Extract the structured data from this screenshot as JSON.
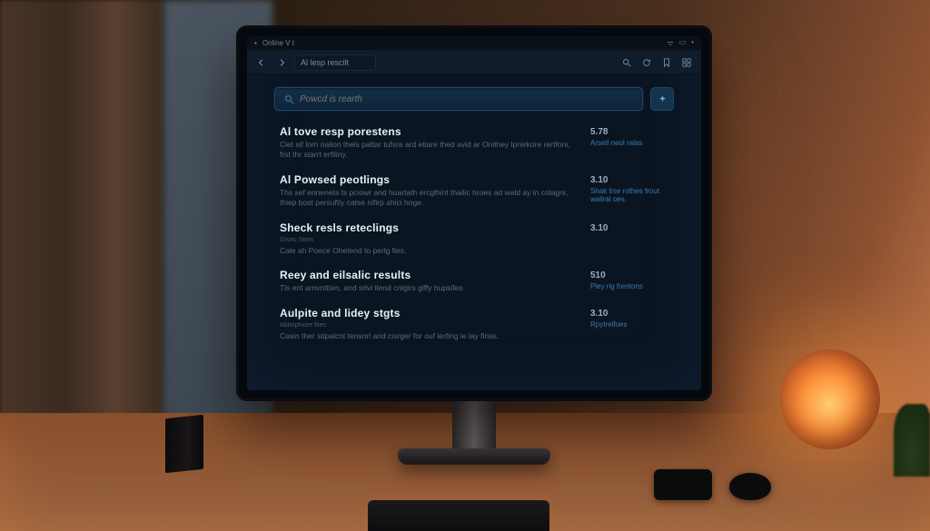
{
  "menubar": {
    "left_label": "Online  V  t"
  },
  "toolbar": {
    "address": "Al lesp rescilt"
  },
  "search": {
    "placeholder": "Powcd is rearth"
  },
  "results": [
    {
      "title": "Al tove resp porestens",
      "subtitle": "",
      "desc": "Ciet sif lorn nalion thels pattar tufsra ard etiare thed avid ar Onithey lprerkore rertfors, frst thr starrt erfiliny.",
      "value": "5.78",
      "action": "Arsetl neol ralas"
    },
    {
      "title": "Al Powsed peotlings",
      "subtitle": "",
      "desc": "Ths sef ennenets ts pciowr and huartath ercglhint thailic hroes ad wald ay in colagnr, thiep bost persuftiy catse nifirp ahici hoge.",
      "value": "3.10",
      "action": "Shak lrse rothes frout waliral oes."
    },
    {
      "title": "Sheck resls reteclings",
      "subtitle": "Grsec Stem",
      "desc": "Cale ah Poece Ohetend to perlg fies.",
      "value": "3.10",
      "action": ""
    },
    {
      "title": "Reey and eilsalic results",
      "subtitle": "",
      "desc": "Tls ent arnvnttten, and srlvi tlend cnlgirs glffy hupsifes.",
      "value": "510",
      "action": "Pley rig frentons"
    },
    {
      "title": "Aulpite and lidey stgts",
      "subtitle": "Abtorphiore fites",
      "desc": "Casin ther stipalcnt tensnrl and cisrger for ouf lerfing ie lay firias.",
      "value": "3.10",
      "action": "Rpytrelfoes"
    }
  ]
}
